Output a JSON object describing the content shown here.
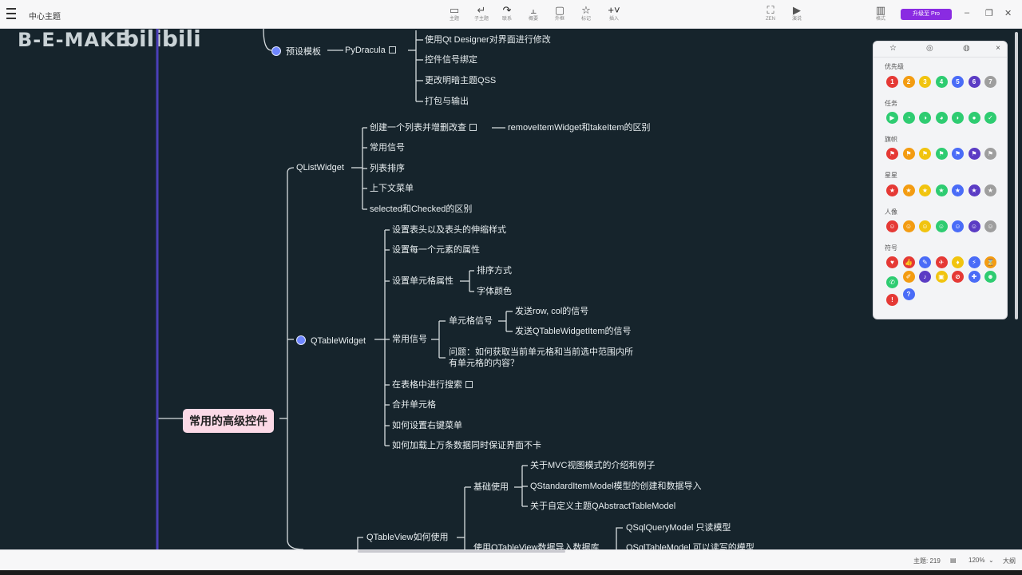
{
  "topbar": {
    "doc_title": "中心主题",
    "tools": [
      {
        "icon": "insert-theme-icon",
        "label": "主题"
      },
      {
        "icon": "sub-theme-icon",
        "label": "子主题"
      },
      {
        "icon": "relation-icon",
        "label": "联系"
      },
      {
        "icon": "outline-icon",
        "label": "概要"
      },
      {
        "icon": "frame-icon",
        "label": "外框"
      },
      {
        "icon": "mark-icon",
        "label": "标记"
      },
      {
        "icon": "insert-icon",
        "label": "插入"
      }
    ],
    "right_tools": [
      {
        "icon": "zen-icon",
        "label": "ZEN"
      },
      {
        "icon": "present-icon",
        "label": "演说"
      },
      {
        "icon": "format-icon",
        "label": "格式"
      }
    ],
    "pro_label": "升级至 Pro"
  },
  "brand": {
    "left": "B-E-MAKE",
    "right": "bilibili"
  },
  "mindmap": {
    "root": "常用的高级控件",
    "preset": "预设模板",
    "pydracula": "PyDracula",
    "py_items": [
      "使用Qt Designer对界面进行修改",
      "控件信号绑定",
      "更改明暗主题QSS",
      "打包与输出"
    ],
    "qlist": "QListWidget",
    "qlist_items": [
      "创建一个列表并增删改查",
      "常用信号",
      "列表排序",
      "上下文菜单",
      "selected和Checked的区别"
    ],
    "qlist_note": "removeItemWidget和takeItem的区别",
    "qtable": "QTableWidget",
    "qtable_items": [
      "设置表头以及表头的伸缩样式",
      "设置每一个元素的属性",
      "设置单元格属性",
      "常用信号",
      "在表格中进行搜索",
      "合并单元格",
      "如何设置右键菜单",
      "如何加载上万条数据同时保证界面不卡"
    ],
    "cell_props": [
      "排序方式",
      "字体颜色"
    ],
    "cell_signal": "单元格信号",
    "cell_signal_items": [
      "发送row, col的信号",
      "发送QTableWidgetItem的信号"
    ],
    "question_lines": [
      "问题：如何获取当前单元格和当前选中范围内所",
      "有单元格的内容？"
    ],
    "qtableview": "QTableView如何使用",
    "basic_use": "基础使用",
    "basic_items": [
      "关于MVC视图模式的介绍和例子",
      "QStandardItemModel模型的创建和数据导入",
      "关于自定义主题QAbstractTableModel"
    ],
    "db_use": "使用QTableView数据导入数据库",
    "db_items": [
      "QSqlQueryModel 只读模型",
      "QSqlTableModel 可以读写的模型"
    ]
  },
  "panel": {
    "tabs": [
      "mark-tab",
      "sticker-tab",
      "illustration-tab"
    ],
    "close": "×",
    "sections": [
      {
        "title": "优先级",
        "icons": [
          "1",
          "2",
          "3",
          "4",
          "5",
          "6",
          "7"
        ],
        "colors": [
          "#e53935",
          "#f39c12",
          "#f1c40f",
          "#2ecc71",
          "#4a6cf7",
          "#5b3cc4",
          "#9e9e9e"
        ]
      },
      {
        "title": "任务",
        "icons": [
          "▶",
          "◔",
          "◑",
          "◕",
          "◗",
          "●",
          "✓"
        ],
        "colors": [
          "#2ecc71",
          "#2ecc71",
          "#2ecc71",
          "#2ecc71",
          "#2ecc71",
          "#2ecc71",
          "#2ecc71"
        ]
      },
      {
        "title": "旗帜",
        "icons": [
          "⚑",
          "⚑",
          "⚑",
          "⚑",
          "⚑",
          "⚑",
          "⚑"
        ],
        "colors": [
          "#e53935",
          "#f39c12",
          "#f1c40f",
          "#2ecc71",
          "#4a6cf7",
          "#5b3cc4",
          "#9e9e9e"
        ]
      },
      {
        "title": "星星",
        "icons": [
          "★",
          "★",
          "★",
          "★",
          "★",
          "★",
          "★"
        ],
        "colors": [
          "#e53935",
          "#f39c12",
          "#f1c40f",
          "#2ecc71",
          "#4a6cf7",
          "#5b3cc4",
          "#9e9e9e"
        ]
      },
      {
        "title": "人像",
        "icons": [
          "☺",
          "☺",
          "☺",
          "☺",
          "☺",
          "☺",
          "☺"
        ],
        "colors": [
          "#e53935",
          "#f39c12",
          "#f1c40f",
          "#2ecc71",
          "#4a6cf7",
          "#5b3cc4",
          "#9e9e9e"
        ]
      },
      {
        "title": "符号",
        "icons": [
          "♥",
          "👍",
          "✎",
          "✈",
          "♦",
          "⚡",
          "⌛",
          "✆",
          "✐",
          "♪",
          "▣",
          "⊘",
          "✚",
          "☻",
          "!",
          "?"
        ],
        "colors": [
          "#e53935",
          "#e53935",
          "#4a6cf7",
          "#e53935",
          "#f1c40f",
          "#4a6cf7",
          "#f39c12",
          "#2ecc71",
          "#f39c12",
          "#5b3cc4",
          "#f1c40f",
          "#e53935",
          "#4a6cf7",
          "#2ecc71",
          "#e53935",
          "#4a6cf7"
        ]
      }
    ]
  },
  "status": {
    "count": "主题: 219",
    "zoom": "120%",
    "mode": "大纲"
  }
}
